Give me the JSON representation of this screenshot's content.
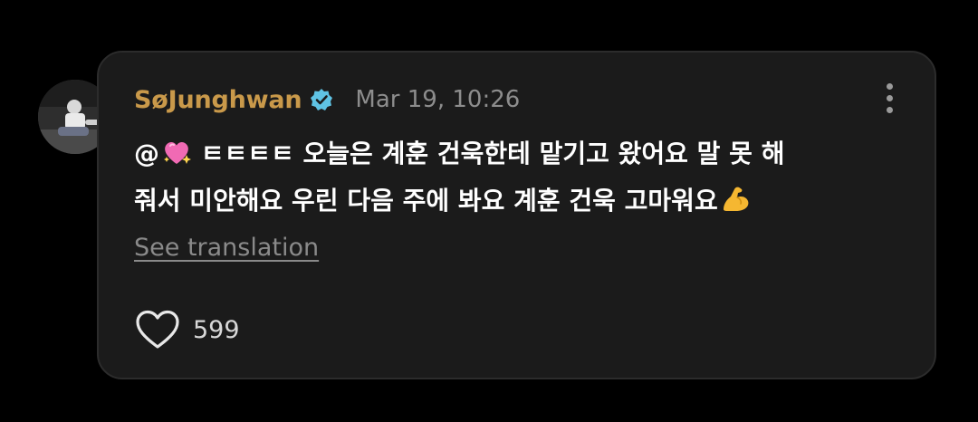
{
  "post": {
    "username": "SøJunghwan",
    "timestamp": "Mar 19, 10:26",
    "text_line1_prefix": "@",
    "text_line1_rest": " ㅌㅌㅌㅌ 오늘은 계훈 건욱한테 맡기고 왔어요 말 못 해",
    "text_line2": "줘서 미안해요 우린 다음 주에 봐요 계훈 건욱 고마워요",
    "translation_link": "See translation",
    "like_count": "599"
  },
  "icons": {
    "verified": "verified-badge-icon",
    "more": "more-vertical-icon",
    "heart": "heart-outline-icon",
    "sparkling_heart": "sparkling-heart-emoji",
    "muscle": "flexed-biceps-emoji"
  },
  "colors": {
    "background": "#000000",
    "card": "#1b1b1b",
    "username": "#c9994a",
    "verified": "#5fc3e4",
    "timestamp": "#8d8d8d"
  }
}
